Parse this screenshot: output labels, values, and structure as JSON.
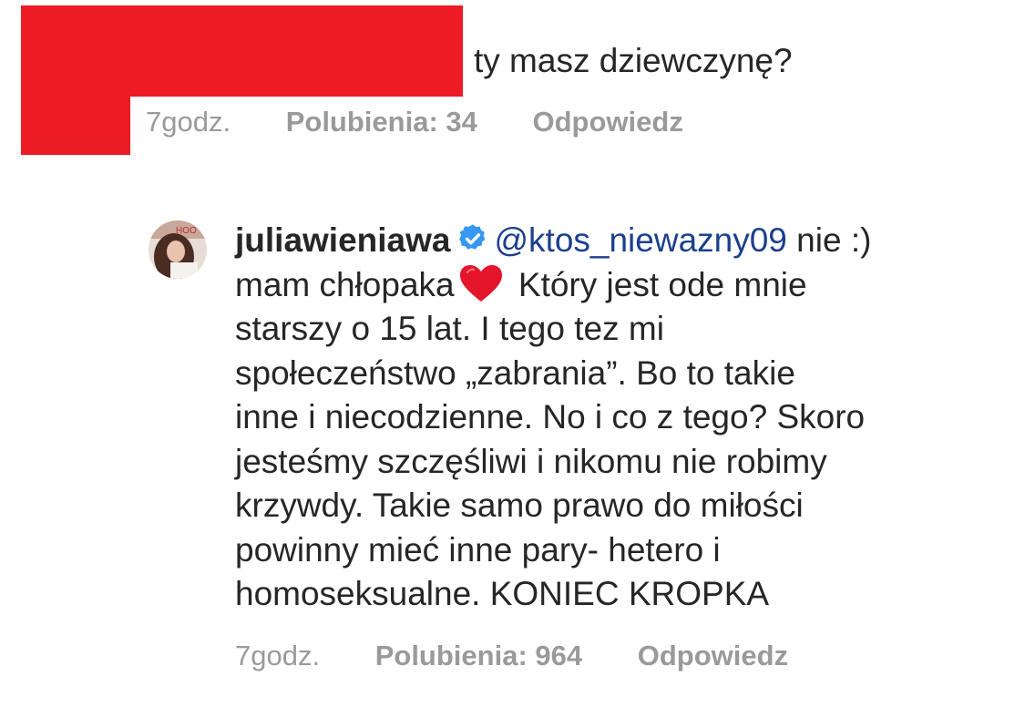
{
  "comment_1": {
    "text": "ty masz dziewczynę?",
    "meta": {
      "time": "7godz.",
      "likes": "Polubienia: 34",
      "reply": "Odpowiedz"
    }
  },
  "comment_2": {
    "username": "juliawieniawa",
    "verified_icon": "verified-badge-icon",
    "mention": "@ktos_niewazny09",
    "text_1": " nie :)\nmam chłopaka",
    "emoji": "red-heart-icon",
    "text_2": " Który jest ode mnie\nstarszy o 15 lat. I tego tez mi\nspołeczeństwo „zabrania”. Bo to takie\ninne i niecodzienne. No i co z tego? Skoro\njesteśmy szczęśliwi i nikomu nie robimy\nkrzywdy. Takie samo prawo do miłości\npowinny mieć inne pary- hetero i\nhomoseksualne. KONIEC KROPKA",
    "meta": {
      "time": "7godz.",
      "likes": "Polubienia: 964",
      "reply": "Odpowiedz"
    }
  },
  "colors": {
    "redaction": "#ed1c24",
    "mention": "#1c3f8e",
    "meta": "#9a9a9a",
    "verified": "#3897f0",
    "heart": "#e4152b"
  }
}
